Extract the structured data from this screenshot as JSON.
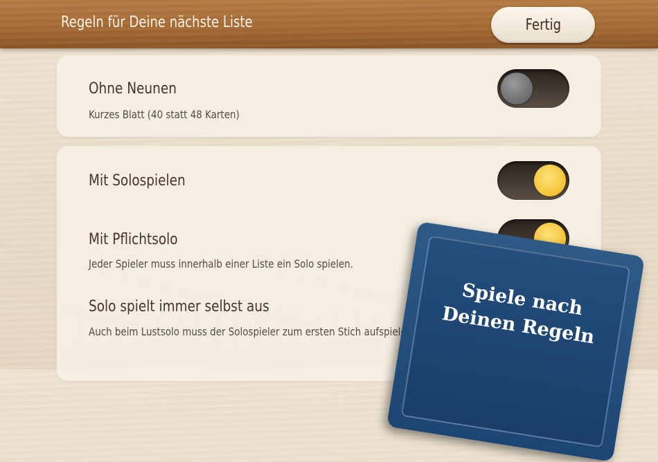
{
  "header": {
    "title": "Regeln für Deine nächste Liste",
    "done_label": "Fertig"
  },
  "rules": [
    {
      "title": "Ohne Neunen",
      "subtitle": "Kurzes Blatt (40 statt 48 Karten)",
      "enabled": false
    },
    {
      "title": "Mit Solospielen",
      "subtitle": "",
      "enabled": true
    },
    {
      "title": "Mit Pflichtsolo",
      "subtitle": "Jeder Spieler muss innerhalb einer Liste ein Solo spielen.",
      "enabled": true
    },
    {
      "title": "Solo spielt immer selbst aus",
      "subtitle": "Auch beim Lustsolo muss der Solospieler zum ersten Stich aufspielen."
    }
  ],
  "promo": {
    "line1": "Spiele nach",
    "line2": "Deinen Regeln"
  },
  "colors": {
    "header_wood": "#a56a33",
    "toggle_on": "#f5c53a",
    "toggle_off": "#727272",
    "promo_blue": "#1d4573"
  }
}
